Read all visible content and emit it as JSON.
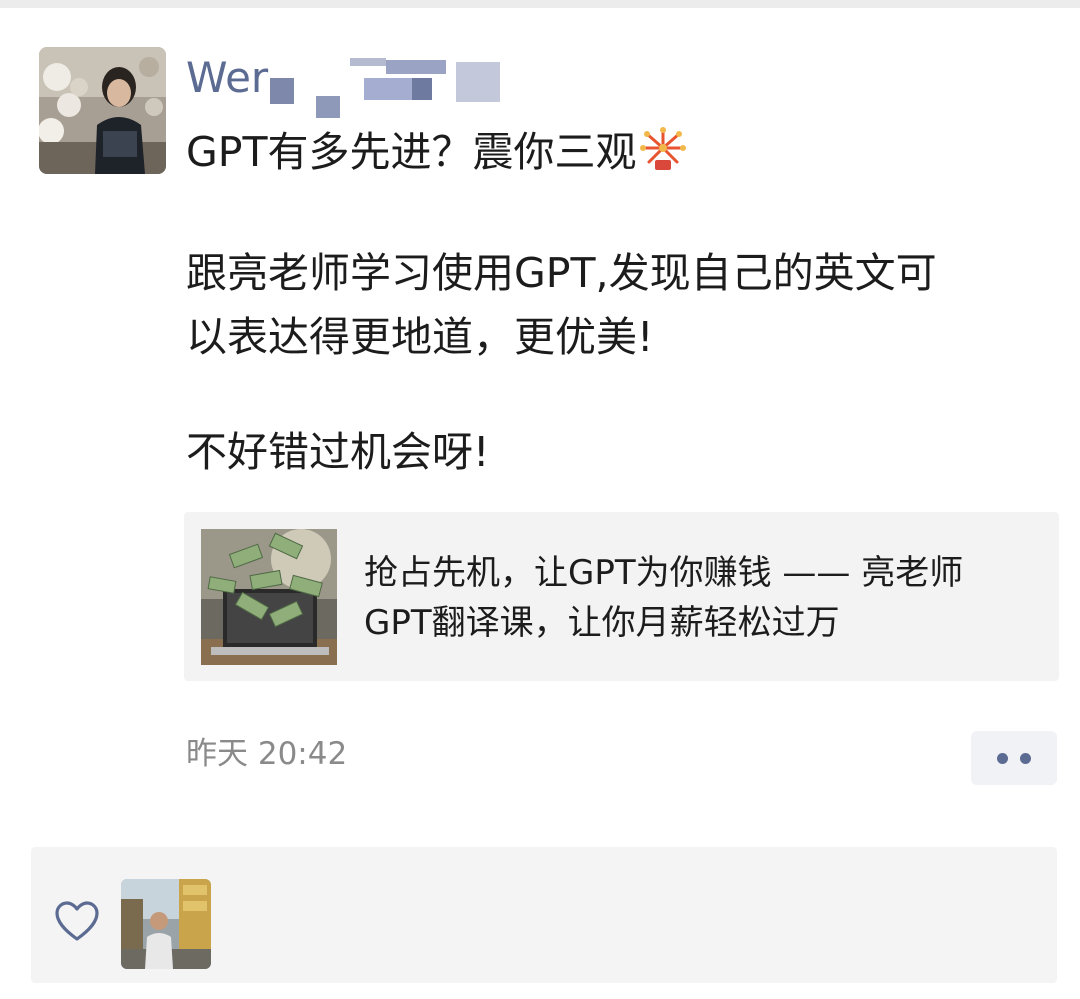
{
  "post": {
    "username": "Wer",
    "line1": "GPT有多先进？震你三观",
    "line2": "跟亮老师学习使用GPT,发现自己的英文可",
    "line3": "以表达得更地道，更优美!",
    "line4": "不好错过机会呀!",
    "link_title_line1": "抢占先机，让GPT为你赚钱 —— 亮老师",
    "link_title_line2": "GPT翻译课，让你月薪轻松过万",
    "timestamp": "昨天 20:42"
  },
  "icons": {
    "emoji": "firework-icon",
    "more": "more-dots-icon",
    "like": "heart-icon"
  },
  "colors": {
    "username": "#5b6b92",
    "text": "#1c1c1c",
    "timestamp": "#8a8a8a",
    "card_bg": "#f3f3f3",
    "panel_bg": "#f4f4f4"
  }
}
